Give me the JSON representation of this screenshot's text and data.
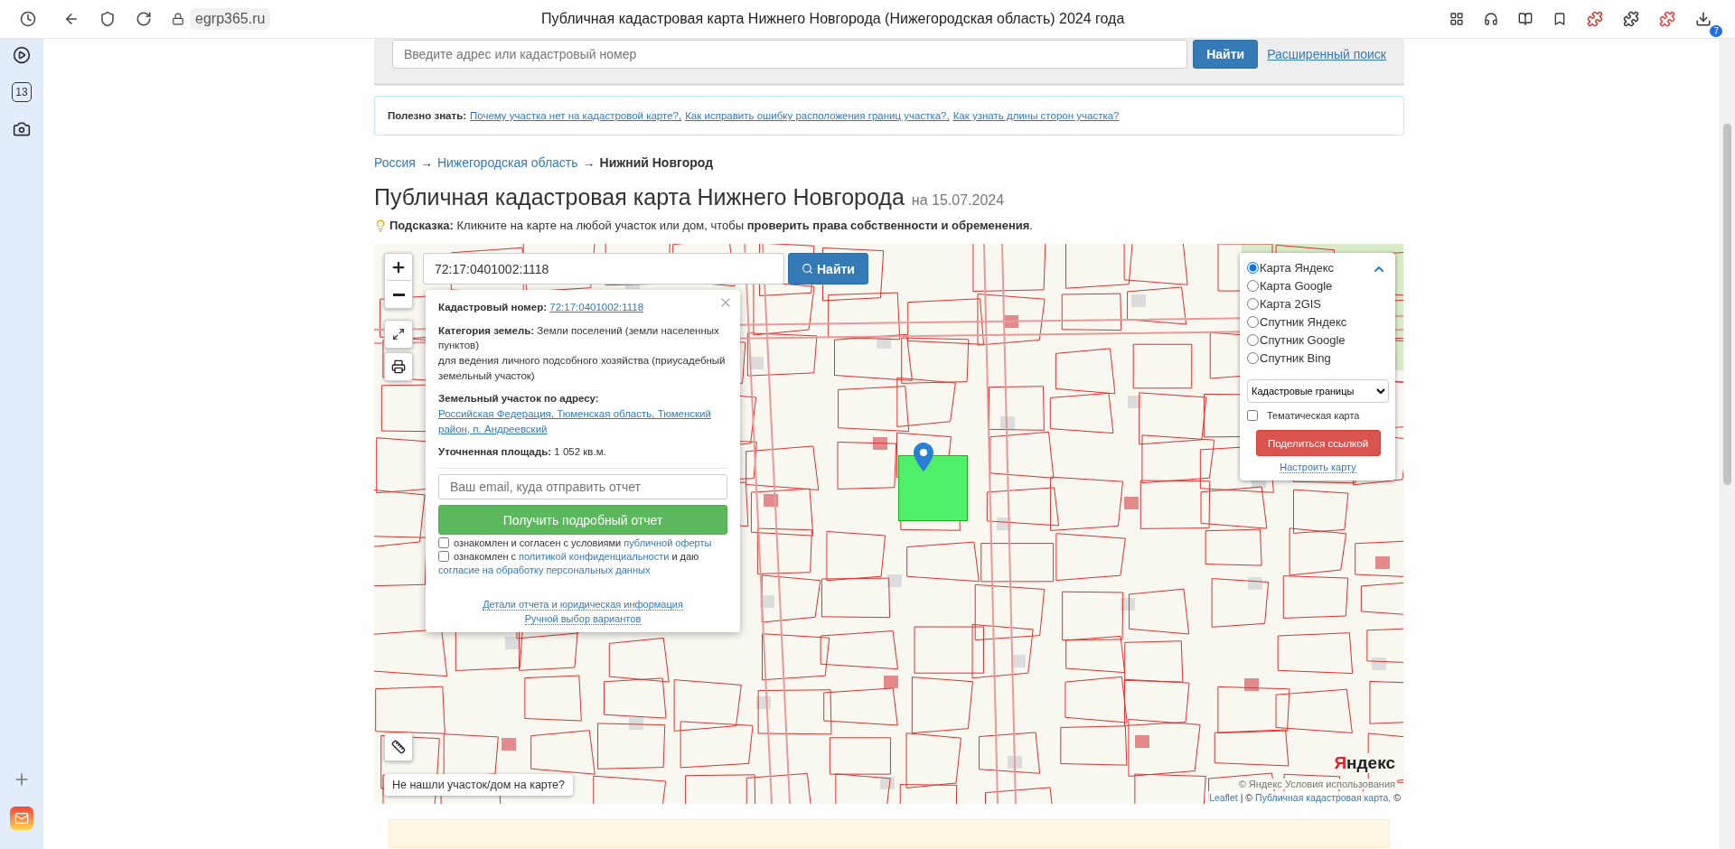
{
  "browser": {
    "url": "egrp365.ru",
    "title": "Публичная кадастровая карта Нижнего Новгорода (Нижегородская область) 2024 года",
    "download_badge": "7"
  },
  "sidebar": {
    "calendar_day": "13"
  },
  "search": {
    "placeholder": "Введите адрес или кадастровый номер",
    "button": "Найти",
    "advanced_link": "Расширенный поиск"
  },
  "notice": {
    "label": "Полезно знать:",
    "links": [
      "Почему участка нет на кадастровой карте?,",
      "Как исправить ошибку расположения границ участка?,",
      "Как узнать длины сторон участка?"
    ]
  },
  "breadcrumb": {
    "separator": "→",
    "items": [
      {
        "label": "Россия",
        "link": true
      },
      {
        "label": "Нижегородская область",
        "link": true
      },
      {
        "label": "Нижний Новгород",
        "link": false
      }
    ]
  },
  "heading": {
    "title": "Публичная кадастровая карта Нижнего Новгорода",
    "date": "на 15.07.2024"
  },
  "hint": "**Подсказка:** Кликните на карте на любой участок или дом, чтобы **проверить права собственности и обременения**.",
  "map": {
    "search": {
      "value": "72:17:0401002:1118",
      "button": "Найти"
    },
    "popup": {
      "fields": [
        {
          "kind": "link",
          "label": "Кадастровый номер:",
          "value": "72:17:0401002:1118"
        },
        {
          "kind": "text",
          "text": "**Категория земель:** Земли поселений (земли населенных пунктов)",
          "detail": "для ведения личного подсобного хозяйства (приусадебный земельный участок)"
        },
        {
          "kind": "link",
          "label": "Земельный участок по адресу:",
          "value": "Российская Федерация, Тюменская область, Тюменский район, п. Андреевский"
        },
        {
          "kind": "text",
          "text": "**Уточненная площадь:** 1 052 кв.м."
        }
      ],
      "email_placeholder": "Ваш email, куда отправить отчет",
      "submit": "Получить подробный отчет",
      "consents": [
        {
          "checked": false,
          "parts": [
            {
              "text": "ознакомлен и согласен с условиями",
              "link": false
            },
            {
              "text": "публичной оферты",
              "link": true
            }
          ]
        },
        {
          "checked": false,
          "parts": [
            {
              "text": "ознакомлен с",
              "link": false
            },
            {
              "text": "политикой конфиденциальности",
              "link": true
            },
            {
              "text": "и даю",
              "link": false
            },
            {
              "text": "согласие на обработку персональных данных",
              "link": true
            }
          ]
        }
      ],
      "links": [
        "Детали отчета и юридическая информация",
        "Ручной выбор вариантов"
      ]
    },
    "layers": {
      "options": [
        {
          "label": "Карта Яндекс",
          "selected": true
        },
        {
          "label": "Карта Google",
          "selected": false
        },
        {
          "label": "Карта 2GIS",
          "selected": false
        },
        {
          "label": "Спутник Яндекс",
          "selected": false
        },
        {
          "label": "Спутник Google",
          "selected": false
        },
        {
          "label": "Спутник Bing",
          "selected": false
        }
      ],
      "overlay_select": "Кадастровые границы",
      "thematic": {
        "label": "Тематическая карта",
        "checked": false
      },
      "share": "Поделиться ссылкой",
      "configure": "Настроить карту"
    },
    "help_tip": "Не нашли участок/дом на карте?",
    "logo": "Яндекс",
    "faded_attribution": "© Яндекс  Условия использования",
    "attribution": [
      {
        "text": "Leaflet",
        "link": true
      },
      {
        "text": "| ©",
        "link": false
      },
      {
        "text": "Публичная кадастровая карта,",
        "link": true
      },
      {
        "text": "©",
        "link": false
      }
    ]
  }
}
